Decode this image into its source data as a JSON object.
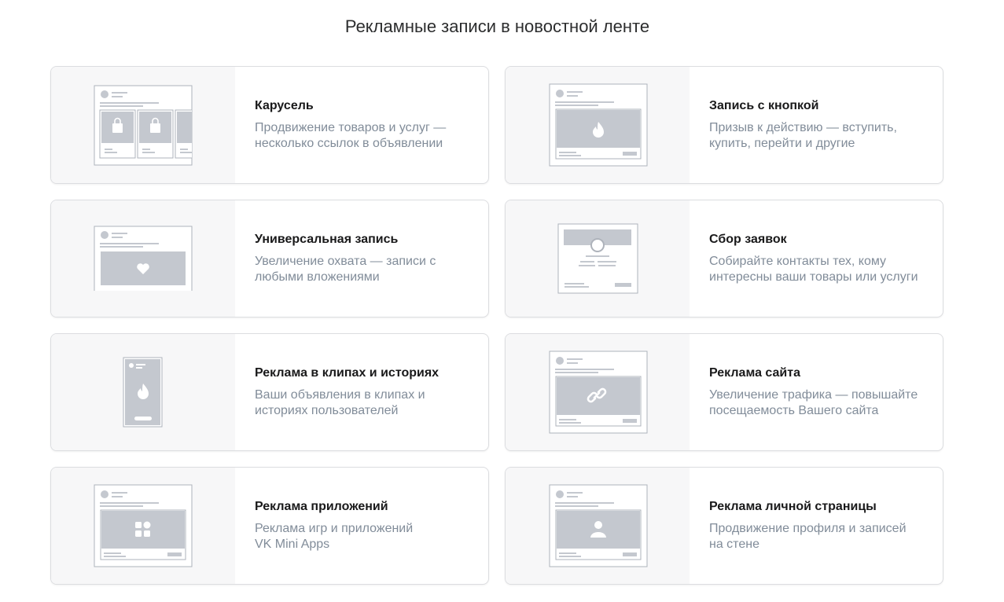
{
  "page": {
    "title": "Рекламные записи в новостной ленте"
  },
  "cards": [
    {
      "title": "Карусель",
      "desc": [
        "Продвижение товаров и услуг —",
        "несколько ссылок в объявлении"
      ],
      "icon": "carousel-illustration"
    },
    {
      "title": "Запись с кнопкой",
      "desc": [
        "Призыв к действию — вступить,",
        "купить, перейти и другие"
      ],
      "icon": "button-post-illustration"
    },
    {
      "title": "Универсальная запись",
      "desc": [
        "Увеличение охвата — записи с",
        "любыми вложениями"
      ],
      "icon": "universal-post-illustration"
    },
    {
      "title": "Сбор заявок",
      "desc": [
        "Собирайте контакты тех, кому",
        "интересны ваши товары или услуги"
      ],
      "icon": "lead-form-illustration"
    },
    {
      "title": "Реклама в клипах и историях",
      "desc": [
        "Ваши объявления в клипах и",
        "историях пользователей"
      ],
      "icon": "clips-stories-illustration"
    },
    {
      "title": "Реклама сайта",
      "desc": [
        "Увеличение трафика — повышайте",
        "посещаемость Вашего сайта"
      ],
      "icon": "website-ad-illustration"
    },
    {
      "title": "Реклама приложений",
      "desc": [
        "Реклама игр и приложений",
        "VK Mini Apps"
      ],
      "icon": "apps-ad-illustration"
    },
    {
      "title": "Реклама личной страницы",
      "desc": [
        "Продвижение профиля и записей",
        "на стене"
      ],
      "icon": "profile-ad-illustration"
    }
  ],
  "colors": {
    "illustration_fill": "#c4c8cf",
    "illustration_stroke": "#aeb3bb",
    "card_border": "#dcdde0",
    "title_text": "#19191a",
    "description_text": "#818c99"
  }
}
